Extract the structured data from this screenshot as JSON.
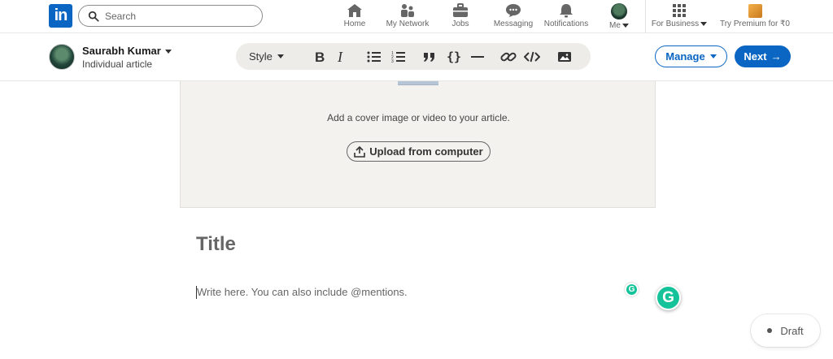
{
  "nav": {
    "logo": "in",
    "search_placeholder": "Search",
    "items": [
      {
        "label": "Home",
        "icon": "home-icon"
      },
      {
        "label": "My Network",
        "icon": "network-icon"
      },
      {
        "label": "Jobs",
        "icon": "briefcase-icon"
      },
      {
        "label": "Messaging",
        "icon": "chat-icon"
      },
      {
        "label": "Notifications",
        "icon": "bell-icon"
      },
      {
        "label": "Me",
        "icon": "avatar"
      },
      {
        "label": "For Business",
        "icon": "grid-icon"
      },
      {
        "label": "Try Premium for ₹0",
        "icon": "premium-icon"
      }
    ]
  },
  "editor": {
    "author_name": "Saurabh Kumar",
    "author_sub": "Individual article",
    "toolbar": {
      "style_label": "Style",
      "tools": [
        "bold-icon",
        "italic-icon",
        "bullet-list-icon",
        "numbered-list-icon",
        "quote-icon",
        "code-block-icon",
        "divider-icon",
        "link-icon",
        "embed-code-icon",
        "image-icon"
      ]
    },
    "manage_label": "Manage",
    "next_label": "Next"
  },
  "cover": {
    "text": "Add a cover image or video to your article.",
    "upload_label": "Upload from computer"
  },
  "article": {
    "title_placeholder": "Title",
    "body_placeholder": "Write here. You can also include @mentions."
  },
  "status": {
    "draft_label": "Draft"
  },
  "colors": {
    "brand": "#0a66c2",
    "grammarly": "#15c39a",
    "cover_bg": "#f3f2ef"
  }
}
